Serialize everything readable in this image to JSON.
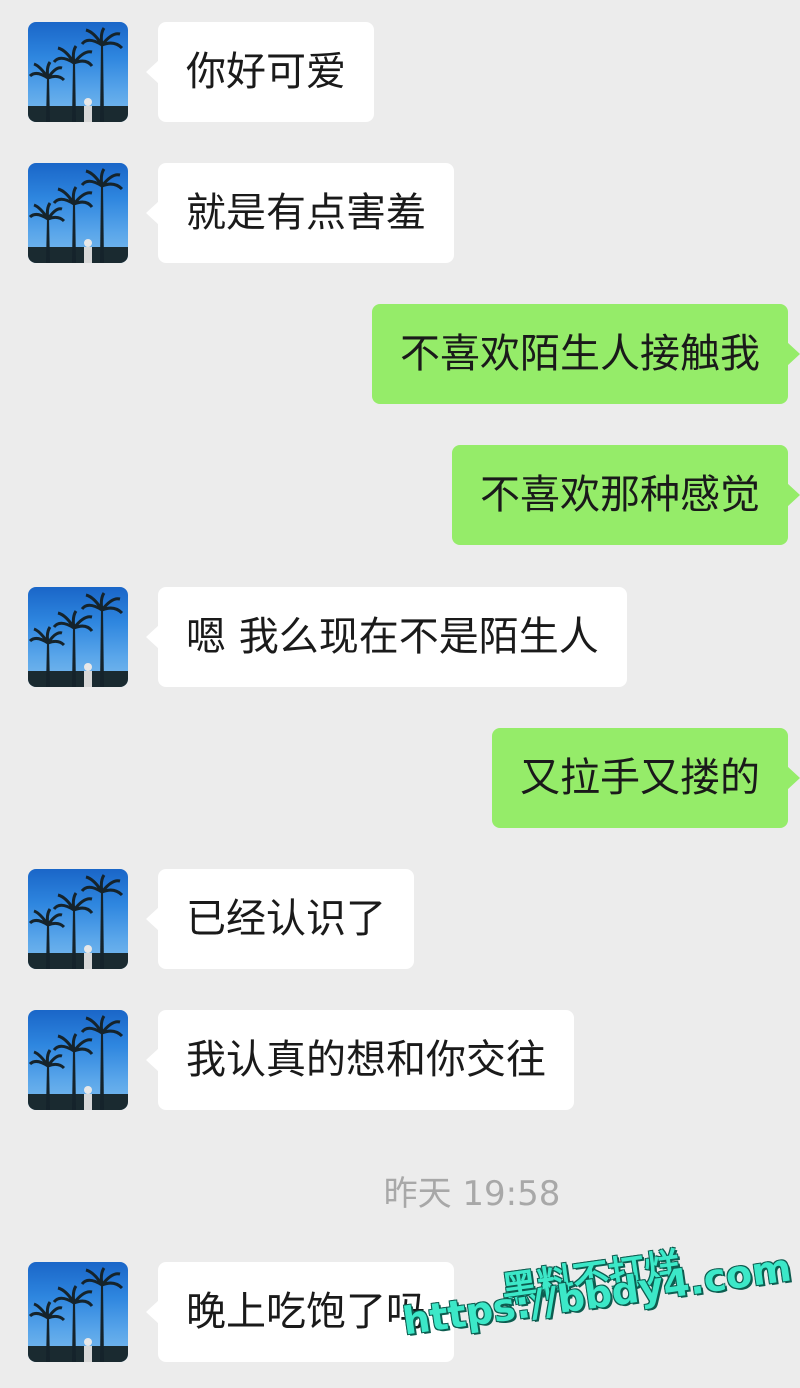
{
  "messages": [
    {
      "side": "in",
      "text": "你好可爱"
    },
    {
      "side": "in",
      "text": "就是有点害羞"
    },
    {
      "side": "out",
      "text": "不喜欢陌生人接触我"
    },
    {
      "side": "out",
      "text": "不喜欢那种感觉"
    },
    {
      "side": "in",
      "text": "嗯 我么现在不是陌生人"
    },
    {
      "side": "out",
      "text": "又拉手又搂的"
    },
    {
      "side": "in",
      "text": "已经认识了"
    },
    {
      "side": "in",
      "text": "我认真的想和你交往"
    },
    {
      "side": "in",
      "text": "晚上吃饱了吗"
    }
  ],
  "timestamp": "昨天 19:58",
  "watermark": {
    "title": "黑料不打烊",
    "url": "https://bbdy4.com"
  },
  "colors": {
    "background": "#ececec",
    "incoming_bubble": "#ffffff",
    "outgoing_bubble": "#95ec69",
    "watermark": "#3ce8c8"
  },
  "icons": {
    "contact_avatar": "palm-trees-avatar-icon"
  }
}
